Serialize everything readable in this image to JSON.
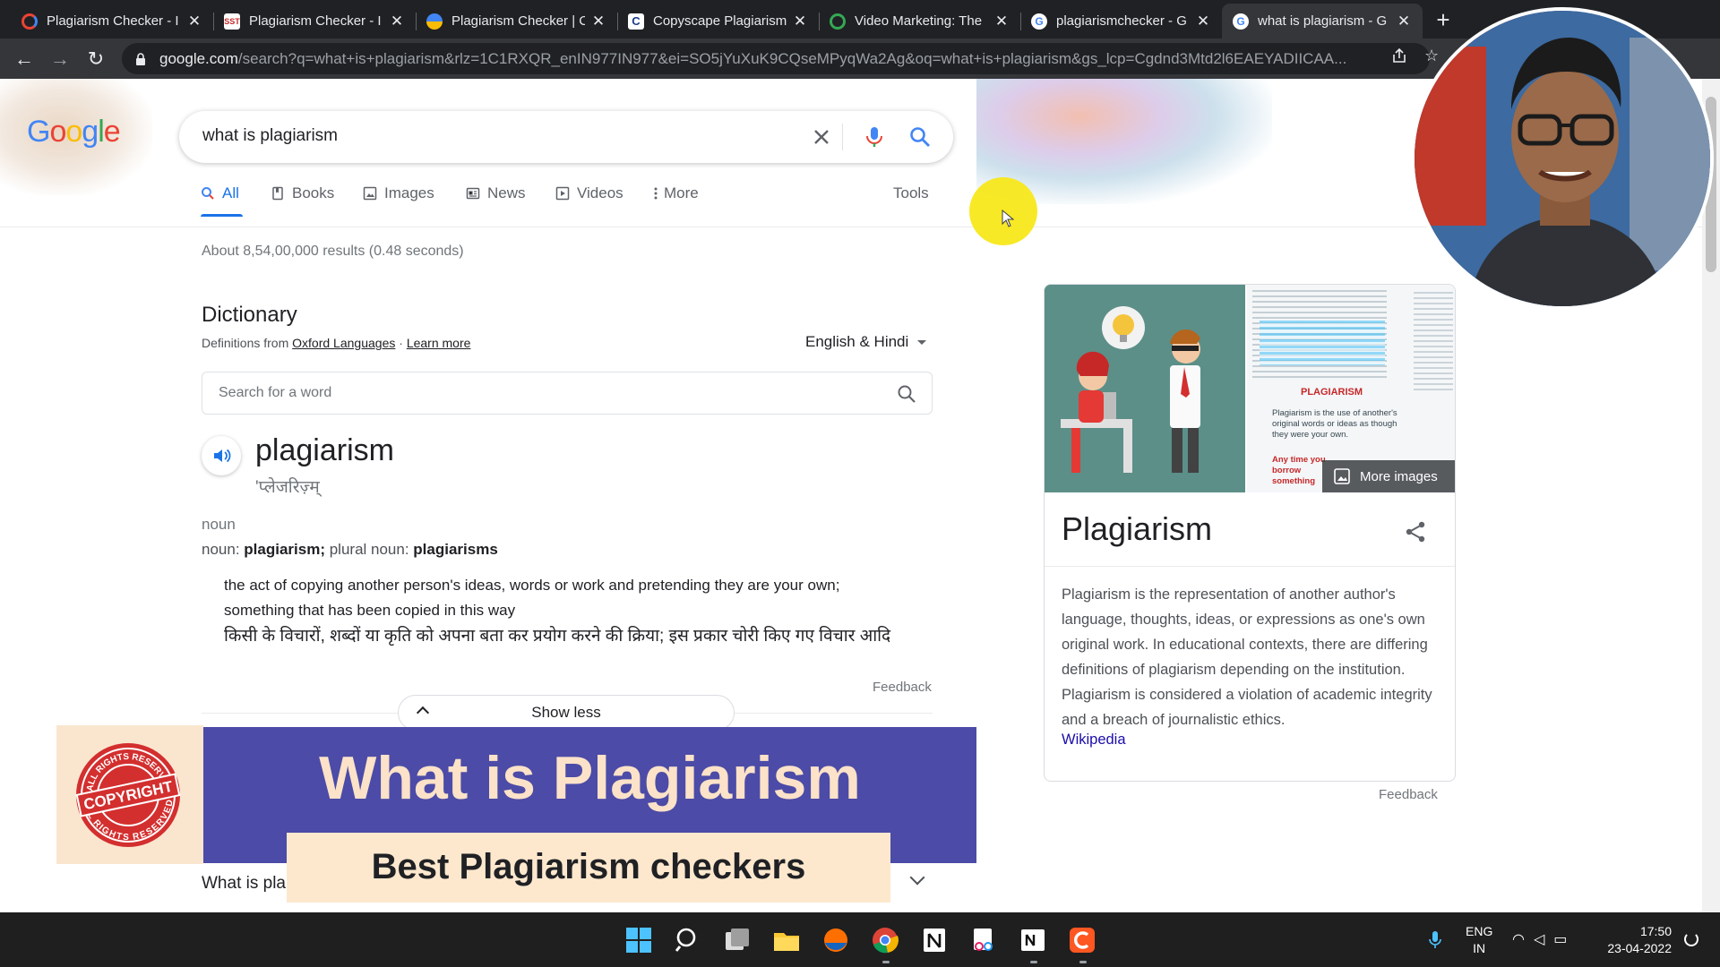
{
  "browser": {
    "tabs": [
      {
        "title": "Plagiarism Checker - I",
        "favicon_color": "#ea4335",
        "active": false
      },
      {
        "title": "Plagiarism Checker - I",
        "favicon_color": "#ffffff",
        "favicon_text": "SST",
        "active": false
      },
      {
        "title": "Plagiarism Checker | C",
        "favicon_color": "#4285f4",
        "active": false
      },
      {
        "title": "Copyscape Plagiarism",
        "favicon_color": "#ffffff",
        "favicon_text": "C",
        "active": false
      },
      {
        "title": "Video Marketing: The",
        "favicon_color": "#34a853",
        "active": false
      },
      {
        "title": "plagiarismchecker - G",
        "favicon_color": "#ffffff",
        "favicon_text": "G",
        "active": false
      },
      {
        "title": "what is plagiarism - G",
        "favicon_color": "#ffffff",
        "favicon_text": "G",
        "active": true
      }
    ],
    "new_tab_label": "+",
    "url_host": "google.com",
    "url_rest": "/search?q=what+is+plagiarism&rlz=1C1RXQR_enIN977IN977&ei=SO5jYuXuK9CQseMPyqWa2Ag&oq=what+is+plagiarism&gs_lcp=Cgdnd3Mtd2l6EAEYADIICAA..."
  },
  "google": {
    "logo_letters": [
      "G",
      "o",
      "o",
      "g",
      "l",
      "e"
    ],
    "query": "what is plagiarism",
    "tabs": [
      {
        "label": "All",
        "icon": "search-icon",
        "active": true
      },
      {
        "label": "Books",
        "icon": "book-icon",
        "active": false
      },
      {
        "label": "Images",
        "icon": "image-icon",
        "active": false
      },
      {
        "label": "News",
        "icon": "news-icon",
        "active": false
      },
      {
        "label": "Videos",
        "icon": "video-icon",
        "active": false
      },
      {
        "label": "More",
        "icon": "more-vert-icon",
        "active": false
      }
    ],
    "tools_label": "Tools",
    "results_stats": "About 8,54,00,000 results (0.48 seconds)"
  },
  "dictionary": {
    "title": "Dictionary",
    "source_prefix": "Definitions from",
    "source_link": "Oxford Languages",
    "separator": "·",
    "learn_more": "Learn more",
    "language": "English & Hindi",
    "search_placeholder": "Search for a word",
    "word": "plagiarism",
    "pronunciation": "'प्लेजरिज़्म्",
    "part_of_speech": "noun",
    "forms_label_1": "noun:",
    "forms_word_1": "plagiarism;",
    "forms_label_2": "plural noun:",
    "forms_word_2": "plagiarisms",
    "definition_1": "the act of copying another person's ideas, words or work and pretending they are your own;",
    "definition_2": "something that has been copied in this way",
    "definition_hindi": "किसी के विचारों, शब्दों या कृति को अपना बता कर प्रयोग करने की क्रिया; इस प्रकार चोरी किए गए विचार आदि",
    "feedback": "Feedback",
    "show_less": "Show less"
  },
  "knowledge_panel": {
    "more_images": "More images",
    "image2_heading": "PLAGIARISM",
    "image2_text": "Plagiarism is the use of another's original words or ideas as though they were your own.",
    "image2_text_2": "Any time you borrow something developed or ... and do not give",
    "title": "Plagiarism",
    "description": "Plagiarism is the representation of another author's language, thoughts, ideas, or expressions as one's own original work. In educational contexts, there are differing definitions of plagiarism depending on the institution. Plagiarism is considered a violation of academic integrity and a breach of journalistic ethics.",
    "source_link": "Wikipedia",
    "feedback": "Feedback"
  },
  "overlay": {
    "stamp_top": "ALL RIGHTS RESERVED",
    "stamp_center": "COPYRIGHT",
    "stamp_bottom": "ALL RIGHTS RESERVED",
    "headline": "What is Plagiarism",
    "subline": "Best Plagiarism checkers",
    "people_also_ask_fragment": "What is pla"
  },
  "taskbar": {
    "apps": [
      "windows-start",
      "search",
      "task-view",
      "file-explorer",
      "app-orange-blue",
      "chrome",
      "notion",
      "snipping-tool",
      "notion-n",
      "camtasia"
    ],
    "lang_line_1": "ENG",
    "lang_line_2": "IN",
    "time": "17:50",
    "date": "23-04-2022"
  },
  "colors": {
    "accent": "#1a73e8",
    "link": "#1a0dab",
    "banner_blue": "#4c4ba7",
    "banner_cream": "#fde8ce",
    "stamp_red": "#d32f2f",
    "cursor_highlight": "#f8e81c"
  }
}
